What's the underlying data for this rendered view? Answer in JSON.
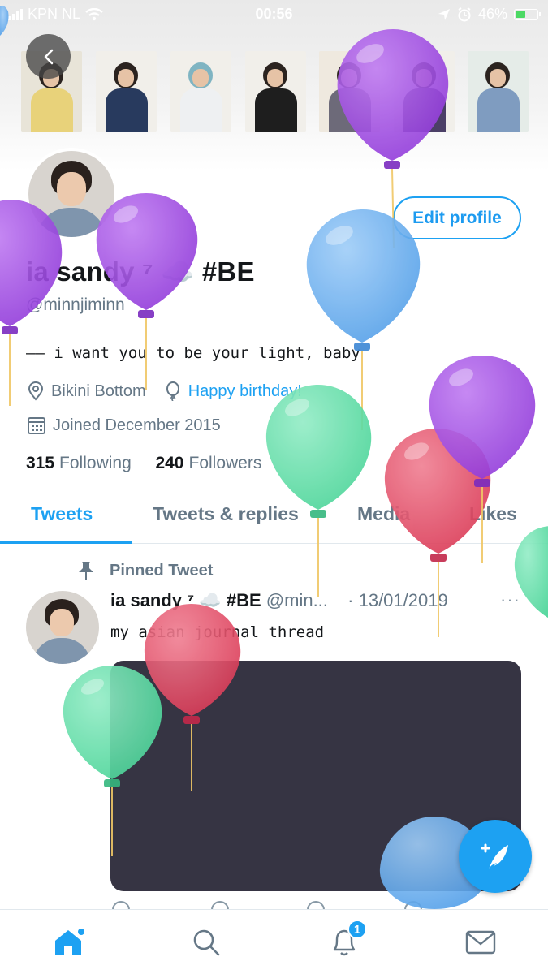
{
  "status_bar": {
    "carrier": "KPN NL",
    "time": "00:56",
    "battery": "46%"
  },
  "profile": {
    "display_name": "ia sandy ⁷ ☁️ #BE",
    "handle": "@minnjiminn",
    "bio": "—— i want you to be your light, baby",
    "location": "Bikini Bottom",
    "birthday_link": "Happy birthday!",
    "joined": "Joined December 2015",
    "following_count": "315",
    "following_label": "Following",
    "followers_count": "240",
    "followers_label": "Followers",
    "edit_button": "Edit profile"
  },
  "tabs": [
    {
      "label": "Tweets"
    },
    {
      "label": "Tweets & replies"
    },
    {
      "label": "Media"
    },
    {
      "label": "Likes"
    }
  ],
  "tweet": {
    "pinned_label": "Pinned Tweet",
    "author_name": "ia sandy ⁷ ☁️ #BE",
    "author_handle": "@min...",
    "date": "· 13/01/2019",
    "text": "my asian journal thread",
    "more": "···"
  },
  "notifications": {
    "badge_count": "1"
  },
  "colors": {
    "accent": "#1da1f2",
    "balloon_purple": "#9b45e0",
    "balloon_blue": "#5aa8f0",
    "balloon_green": "#58dca2",
    "balloon_red": "#e24660"
  }
}
